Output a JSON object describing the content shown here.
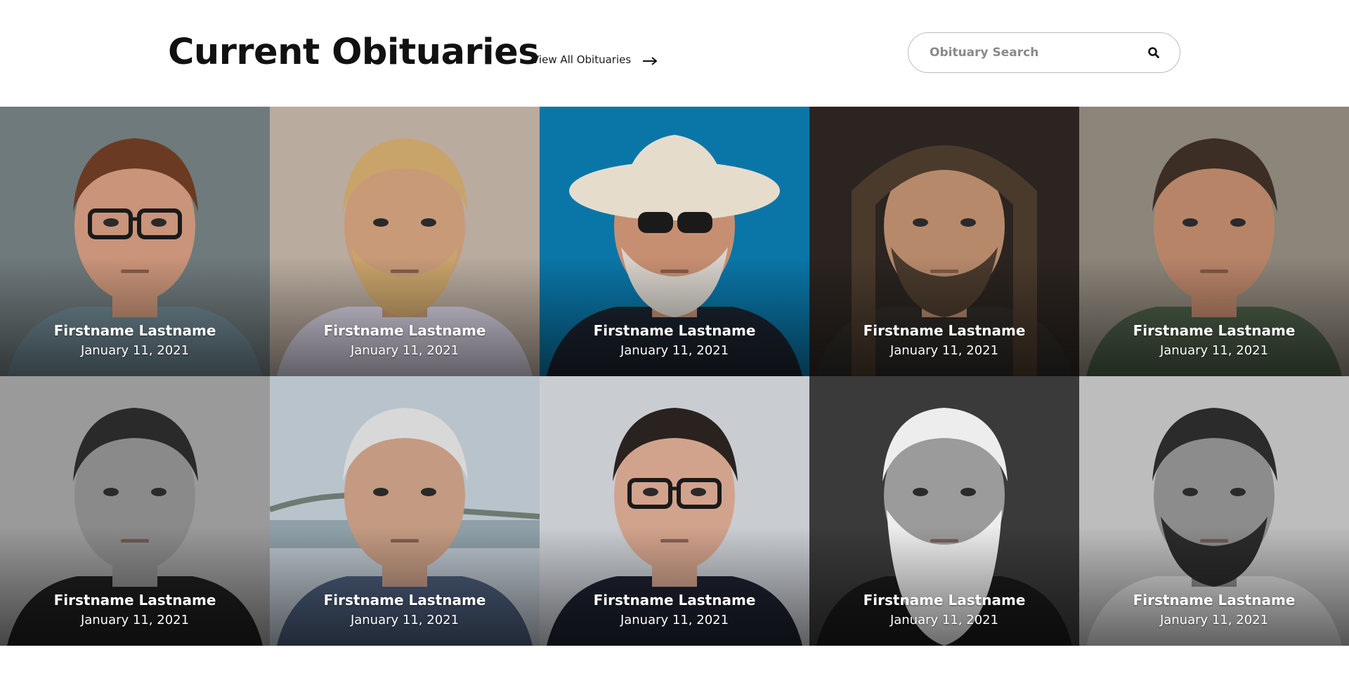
{
  "header": {
    "title": "Current Obituaries",
    "view_all_label": "View All Obituaries",
    "view_all_icon": "arrow-right-icon"
  },
  "search": {
    "placeholder": "Obituary Search",
    "value": "",
    "icon": "search-icon"
  },
  "obituaries": [
    {
      "name": "Firstname Lastname",
      "date": "January 11, 2021",
      "bg": "#6f7a7c",
      "skin": "#c99479",
      "hair": "#6b3a22",
      "shirt": "#6f8893",
      "style": "glasses"
    },
    {
      "name": "Firstname Lastname",
      "date": "January 11, 2021",
      "bg": "#b9ab9e",
      "skin": "#c89a78",
      "hair": "#c9a46a",
      "shirt": "#d8d2e3",
      "style": "beard"
    },
    {
      "name": "Firstname Lastname",
      "date": "January 11, 2021",
      "bg": "#0a76a8",
      "skin": "#c78f72",
      "hair": "#e6dccc",
      "shirt": "#1b2430",
      "style": "hat"
    },
    {
      "name": "Firstname Lastname",
      "date": "January 11, 2021",
      "bg": "#2b2420",
      "skin": "#b7896b",
      "hair": "#4a3a2c",
      "shirt": "#2e2a26",
      "style": "hood"
    },
    {
      "name": "Firstname Lastname",
      "date": "January 11, 2021",
      "bg": "#8c857a",
      "skin": "#b88468",
      "hair": "#3c2e24",
      "shirt": "#4a5d47",
      "style": "plain"
    },
    {
      "name": "Firstname Lastname",
      "date": "January 11, 2021",
      "bg": "#9a9a9a",
      "skin": "#8a8a8a",
      "hair": "#2a2a2a",
      "shirt": "#1e1e1e",
      "style": "plain"
    },
    {
      "name": "Firstname Lastname",
      "date": "January 11, 2021",
      "bg": "#b9c3cc",
      "skin": "#c49a82",
      "hair": "#d8d8d8",
      "shirt": "#4a5c7a",
      "style": "bridge"
    },
    {
      "name": "Firstname Lastname",
      "date": "January 11, 2021",
      "bg": "#c9cdd2",
      "skin": "#d2a38c",
      "hair": "#2a221e",
      "shirt": "#1d2230",
      "style": "glasses"
    },
    {
      "name": "Firstname Lastname",
      "date": "January 11, 2021",
      "bg": "#3a3a3a",
      "skin": "#9b9b9b",
      "hair": "#ededed",
      "shirt": "#1a1a1a",
      "style": "whitebeard"
    },
    {
      "name": "Firstname Lastname",
      "date": "January 11, 2021",
      "bg": "#bdbdbd",
      "skin": "#8c8c8c",
      "hair": "#2b2b2b",
      "shirt": "#d9d9d9",
      "style": "beard"
    }
  ]
}
